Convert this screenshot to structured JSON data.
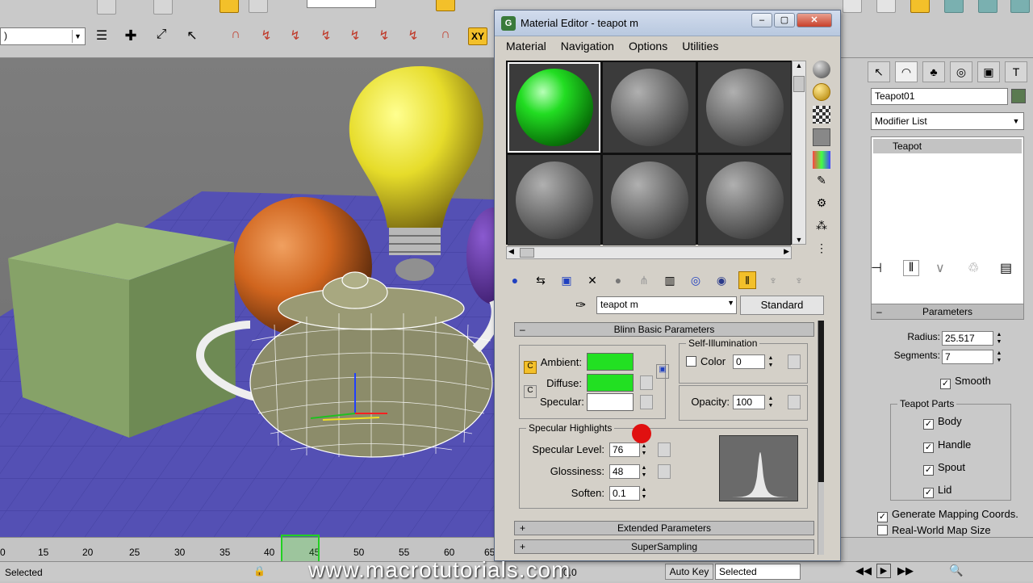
{
  "selection_filter": ")",
  "viewport": {},
  "material_editor": {
    "title": "Material Editor - teapot m",
    "menu": [
      "Material",
      "Navigation",
      "Options",
      "Utilities"
    ],
    "material_name": "teapot m",
    "material_type": "Standard",
    "rollouts": {
      "blinn_basic": "Blinn Basic Parameters",
      "extended": "Extended Parameters",
      "supersampling": "SuperSampling"
    },
    "basic": {
      "ambient_label": "Ambient:",
      "diffuse_label": "Diffuse:",
      "specular_label": "Specular:",
      "ambient_color": "#22e022",
      "diffuse_color": "#22e022",
      "specular_color": "#ffffff",
      "self_illum_title": "Self-Illumination",
      "color_label": "Color",
      "self_illum_value": "0",
      "opacity_label": "Opacity:",
      "opacity_value": "100"
    },
    "highlights": {
      "title": "Specular Highlights",
      "level_label": "Specular Level:",
      "level_value": "76",
      "gloss_label": "Glossiness:",
      "gloss_value": "48",
      "soften_label": "Soften:",
      "soften_value": "0.1"
    },
    "sample_slots": [
      "green",
      "gray",
      "gray",
      "gray",
      "gray",
      "gray"
    ]
  },
  "command_panel": {
    "object_name": "Teapot01",
    "object_color": "#5a7a50",
    "modifier_list": "Modifier List",
    "stack_item": "Teapot",
    "params_title": "Parameters",
    "radius_label": "Radius:",
    "radius_value": "25.517",
    "segments_label": "Segments:",
    "segments_value": "7",
    "smooth_label": "Smooth",
    "parts_title": "Teapot Parts",
    "parts": [
      "Body",
      "Handle",
      "Spout",
      "Lid"
    ],
    "gen_mapping": "Generate Mapping Coords.",
    "real_world": "Real-World Map Size"
  },
  "timeline": {
    "ticks": [
      "0",
      "15",
      "20",
      "25",
      "30",
      "35",
      "40",
      "45",
      "50",
      "55",
      "60",
      "65"
    ]
  },
  "statusbar": {
    "left": "Selected",
    "autokey": "Auto Key",
    "selected_dropdown": "Selected",
    "coord_value": "0.0"
  },
  "watermark": "www.macrotutorials.com"
}
